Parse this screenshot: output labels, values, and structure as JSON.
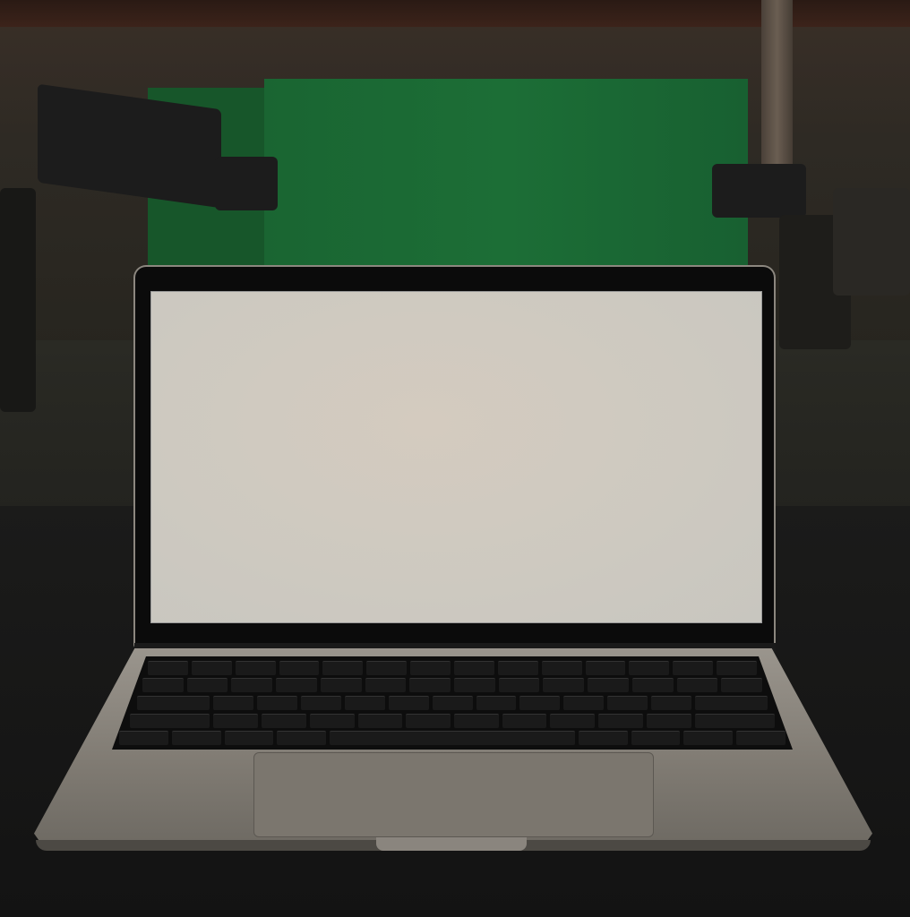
{
  "scene": {
    "colors": {
      "green_screen": "#1c6e36",
      "screen": "#cfcbc2",
      "laptop_body": "#8a857d",
      "table": "#151515"
    },
    "keyboard_rows": [
      14,
      14,
      13,
      12,
      9
    ]
  }
}
